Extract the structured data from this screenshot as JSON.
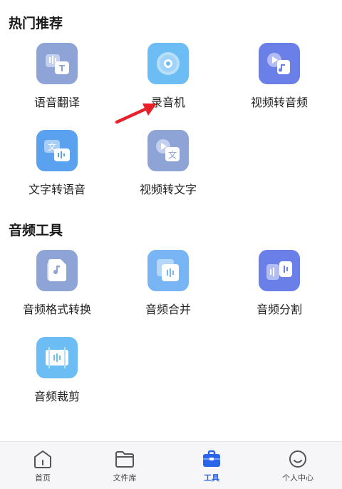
{
  "sections": {
    "hot": {
      "title": "热门推荐"
    },
    "audio": {
      "title": "音频工具"
    }
  },
  "tools": {
    "speech_translate": {
      "label": "语音翻译",
      "icon": "speech-translate-icon"
    },
    "recorder": {
      "label": "录音机",
      "icon": "disc-icon"
    },
    "video_to_audio": {
      "label": "视频转音频",
      "icon": "video-to-audio-icon"
    },
    "text_to_speech": {
      "label": "文字转语音",
      "icon": "text-to-speech-icon"
    },
    "video_to_text": {
      "label": "视频转文字",
      "icon": "video-to-text-icon"
    },
    "format_convert": {
      "label": "音频格式转换",
      "icon": "music-file-icon"
    },
    "merge": {
      "label": "音频合并",
      "icon": "audio-merge-icon"
    },
    "split": {
      "label": "音频分割",
      "icon": "audio-split-icon"
    },
    "trim": {
      "label": "音频裁剪",
      "icon": "audio-trim-icon"
    }
  },
  "tabs": {
    "home": {
      "label": "首页"
    },
    "files": {
      "label": "文件库"
    },
    "tools": {
      "label": "工具",
      "active": true
    },
    "profile": {
      "label": "个人中心"
    }
  },
  "colors": {
    "accent": "#2a64e8",
    "annotation_arrow": "#e8202a"
  }
}
